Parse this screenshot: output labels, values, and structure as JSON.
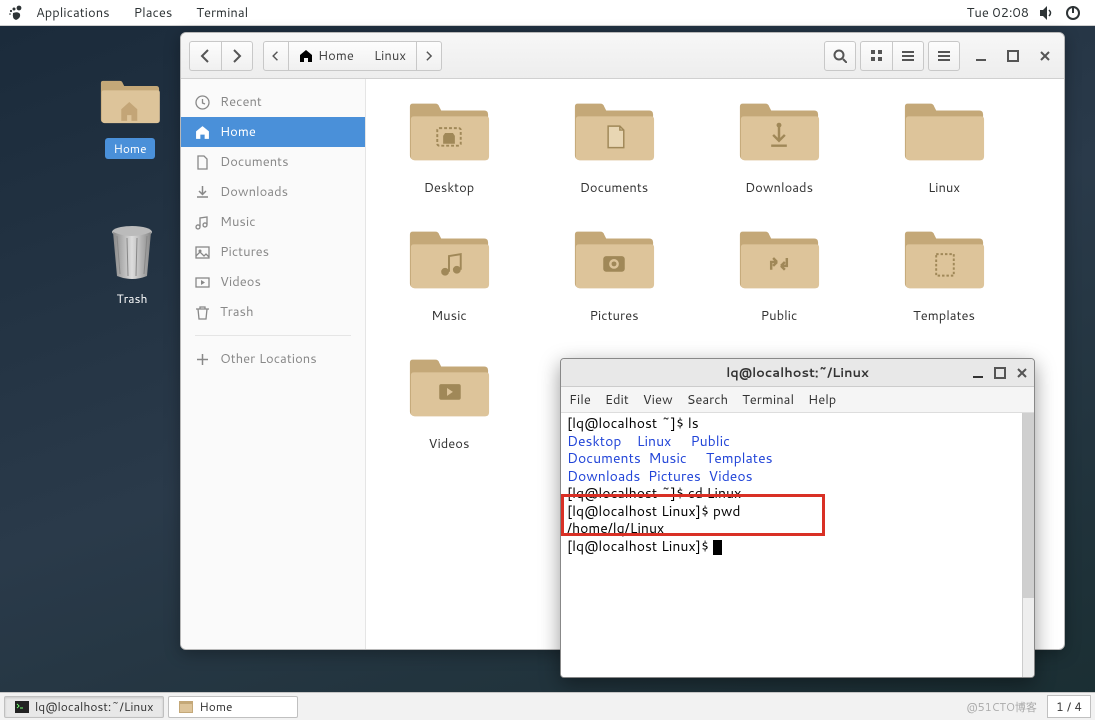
{
  "topbar": {
    "apps": "Applications",
    "places": "Places",
    "terminal": "Terminal",
    "clock": "Tue 02:08"
  },
  "desktop": {
    "home_label": "Home",
    "trash_label": "Trash"
  },
  "fm": {
    "path": {
      "home": "Home",
      "linux": "Linux"
    },
    "sidebar": {
      "recent": "Recent",
      "home": "Home",
      "documents": "Documents",
      "downloads": "Downloads",
      "music": "Music",
      "pictures": "Pictures",
      "videos": "Videos",
      "trash": "Trash",
      "other": "Other Locations"
    },
    "items": {
      "desktop": "Desktop",
      "documents": "Documents",
      "downloads": "Downloads",
      "linux": "Linux",
      "music": "Music",
      "pictures": "Pictures",
      "public": "Public",
      "templates": "Templates",
      "videos": "Videos"
    }
  },
  "term": {
    "title": "lq@localhost:~/Linux",
    "menu": {
      "file": "File",
      "edit": "Edit",
      "view": "View",
      "search": "Search",
      "terminal": "Terminal",
      "help": "Help"
    },
    "lines": {
      "l1a": "[lq@localhost ~]$ ",
      "l1b": "ls",
      "l2a": "Desktop    ",
      "l2b": "Linux     ",
      "l2c": "Public",
      "l3a": "Documents  ",
      "l3b": "Music     ",
      "l3c": "Templates",
      "l4a": "Downloads  ",
      "l4b": "Pictures  ",
      "l4c": "Videos",
      "l5a": "[lq@localhost ~]$ ",
      "l5b": "cd Linux",
      "l6a": "[lq@localhost Linux]$ ",
      "l6b": "pwd",
      "l7": "/home/lq/Linux",
      "l8": "[lq@localhost Linux]$ "
    }
  },
  "taskbar": {
    "term": "lq@localhost:~/Linux",
    "home": "Home",
    "watermark": "@51CTO博客",
    "pager": "1 / 4"
  }
}
